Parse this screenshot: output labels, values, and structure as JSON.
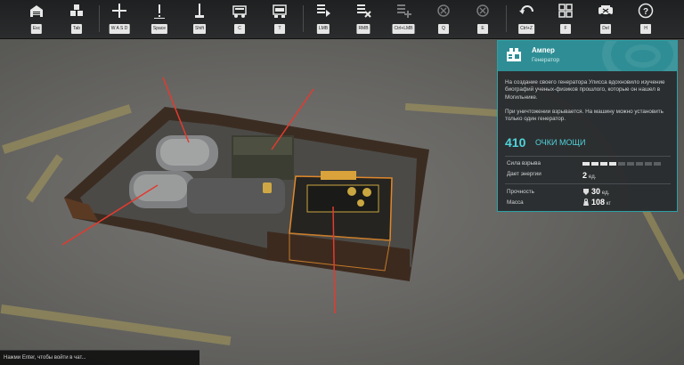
{
  "toolbar": {
    "items": [
      {
        "icon": "garage-icon",
        "key": "Esc"
      },
      {
        "icon": "parts-icon",
        "key": "Tab"
      },
      {
        "icon": "move-icon",
        "key": "W A S D"
      },
      {
        "icon": "warning-icon",
        "key": "Space"
      },
      {
        "icon": "antenna-icon",
        "key": "Shift"
      },
      {
        "icon": "paint-icon",
        "key": "C"
      },
      {
        "icon": "vehicle-icon",
        "key": "T"
      },
      {
        "icon": "select-icon",
        "key": "LMB"
      },
      {
        "icon": "remove-icon",
        "key": "RMB"
      },
      {
        "icon": "add-icon",
        "key": "Ctrl+LMB"
      },
      {
        "icon": "rotate-left-icon",
        "key": "Q"
      },
      {
        "icon": "rotate-right-icon",
        "key": "E"
      },
      {
        "icon": "undo-icon",
        "key": "Ctrl+Z"
      },
      {
        "icon": "layout-icon",
        "key": "F"
      },
      {
        "icon": "car-stats-icon",
        "key": "Del"
      },
      {
        "icon": "help-icon",
        "key": "H"
      }
    ]
  },
  "panel": {
    "name": "Ампер",
    "type": "Генератор",
    "description": "На создание своего генератора Улисса вдохновило изучение биографий ученых-физиков прошлого, которые он нашел в Могильнике.",
    "description2": "При уничтожении взрывается. На машину можно установить только один генератор.",
    "power_value": "410",
    "power_label": "ОЧКИ МОЩИ",
    "explosion_label": "Сила взрыва",
    "explosion_level": 0.4,
    "energy_label": "Дает энергии",
    "energy_value": "2",
    "energy_unit": "ед.",
    "durability_label": "Прочность",
    "durability_value": "30",
    "durability_unit": "ед.",
    "mass_label": "Масса",
    "mass_value": "108",
    "mass_unit": "кг",
    "accent_color": "#2f8e95"
  },
  "chat": {
    "prompt": "Нажми Enter, чтобы войти в чат..."
  }
}
